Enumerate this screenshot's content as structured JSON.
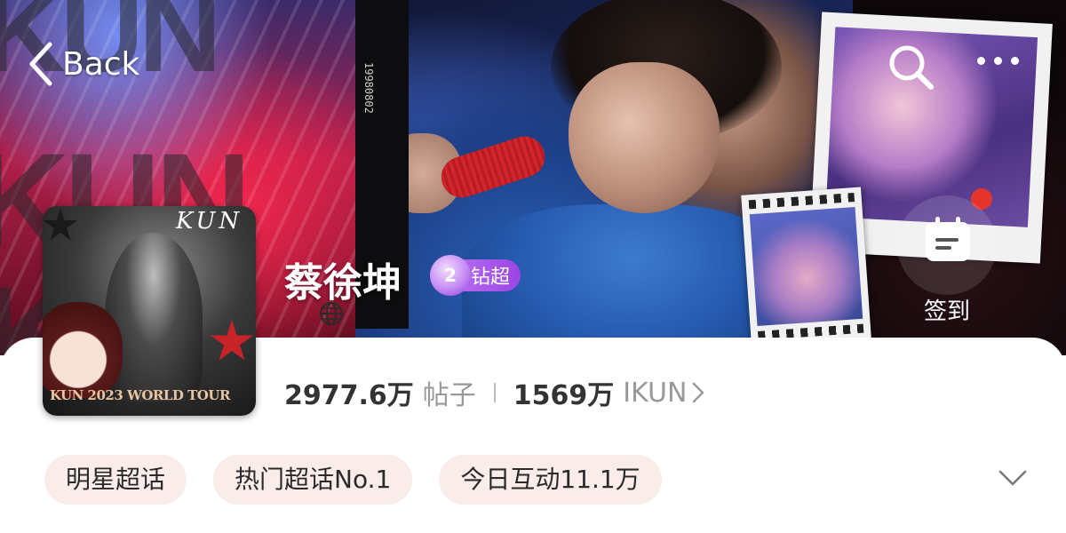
{
  "nav": {
    "back_label": "Back",
    "search_icon": "search-icon",
    "more_icon": "more-icon"
  },
  "banner": {
    "background_text": [
      "KUN",
      "KUN",
      "KUN"
    ],
    "film_label": "19980802",
    "avatar_logo": "KUN",
    "avatar_caption": "KUN 2023 WORLD TOUR"
  },
  "topic": {
    "title": "蔡徐坤",
    "level_number": "2",
    "level_label": "钻超",
    "signin_label": "签到",
    "posts_count": "2977.6万",
    "posts_label": "帖子",
    "fans_count": "1569万",
    "fans_label": "IKUN"
  },
  "tags": [
    "明星超话",
    "热门超话No.1",
    "今日互动11.1万"
  ],
  "colors": {
    "tag_bg": "#faece8",
    "badge_start": "#c07af0",
    "badge_end": "#9b45e6",
    "red_dot": "#e4342d"
  }
}
